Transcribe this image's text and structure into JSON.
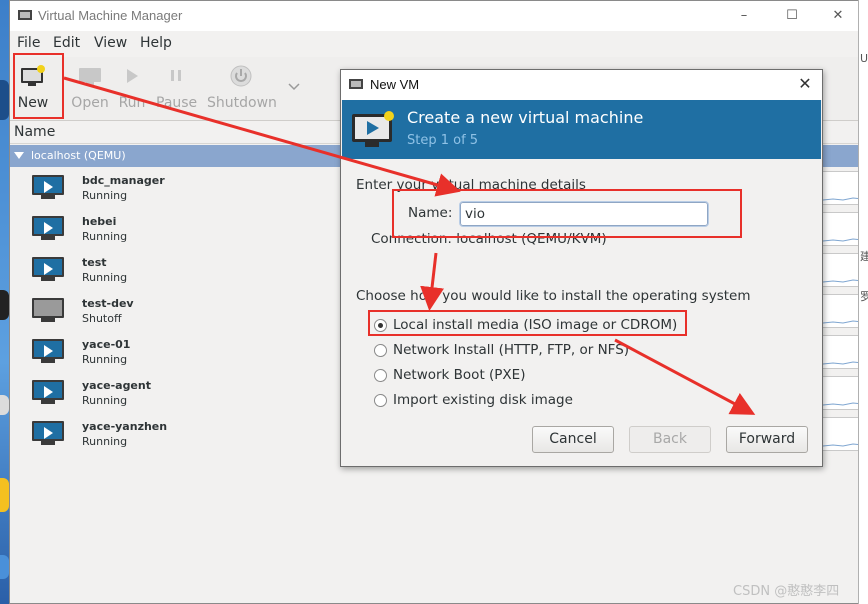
{
  "window": {
    "title": "Virtual Machine Manager"
  },
  "window_controls": {
    "minimize": "–",
    "maximize": "☐",
    "close": "✕"
  },
  "menu": {
    "items": [
      "File",
      "Edit",
      "View",
      "Help"
    ]
  },
  "toolbar": {
    "new": "New",
    "open": "Open",
    "run": "Run",
    "pause": "Pause",
    "shutdown": "Shutdown"
  },
  "list": {
    "header": "Name",
    "group": "localhost (QEMU)",
    "vms": [
      {
        "name": "bdc_manager",
        "status": "Running",
        "state": "running"
      },
      {
        "name": "hebei",
        "status": "Running",
        "state": "running"
      },
      {
        "name": "test",
        "status": "Running",
        "state": "running"
      },
      {
        "name": "test-dev",
        "status": "Shutoff",
        "state": "off"
      },
      {
        "name": "yace-01",
        "status": "Running",
        "state": "running"
      },
      {
        "name": "yace-agent",
        "status": "Running",
        "state": "running"
      },
      {
        "name": "yace-yanzhen",
        "status": "Running",
        "state": "running"
      }
    ]
  },
  "dialog": {
    "title": "New VM",
    "heading": "Create a new virtual machine",
    "step": "Step 1 of 5",
    "details_label": "Enter your virtual machine details",
    "name_label": "Name:",
    "name_value": "vio",
    "connection": "Connection:  localhost (QEMU/KVM)",
    "install_prompt": "Choose how you would like to install the operating system",
    "options": [
      {
        "label": "Local install media (ISO image or CDROM)",
        "checked": true
      },
      {
        "label": "Network Install (HTTP, FTP, or NFS)",
        "checked": false
      },
      {
        "label": "Network Boot (PXE)",
        "checked": false
      },
      {
        "label": "Import existing disk image",
        "checked": false
      }
    ],
    "buttons": {
      "cancel": "Cancel",
      "back": "Back",
      "forward": "Forward"
    }
  },
  "right_edge_fragments": [
    "U",
    "建",
    "罗"
  ],
  "watermark": "CSDN @憨憨李四",
  "colors": {
    "annotation": "#e8302a",
    "banner": "#1f6fa3",
    "group_row": "#8aa6ce",
    "step_text": "#8fc2e6"
  }
}
